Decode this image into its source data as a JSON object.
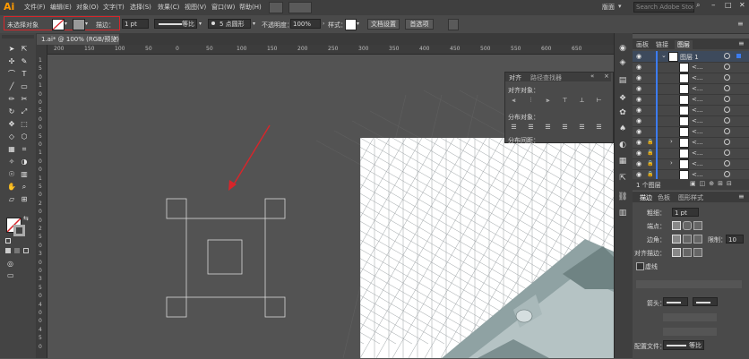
{
  "app": {
    "logo": "Ai"
  },
  "menu": [
    "文件(F)",
    "编辑(E)",
    "对象(O)",
    "文字(T)",
    "选择(S)",
    "效果(C)",
    "视图(V)",
    "窗口(W)",
    "帮助(H)"
  ],
  "window": {
    "workspace": "版面",
    "search_placeholder": "Search Adobe Stock"
  },
  "control": {
    "selection_state": "未选择对象",
    "stroke_label": "描边：",
    "stroke_weight": "1 pt",
    "line_style": "等比",
    "brush": "5 点圆形",
    "opacity_label": "不透明度：",
    "opacity_value": "100%",
    "style_label": "样式：",
    "doc_setup": "文档设置",
    "preferences": "首选项"
  },
  "document": {
    "tab_title": "1.ai* @ 100% (RGB/预览)"
  },
  "ruler": {
    "top": [
      "200",
      "150",
      "100",
      "50",
      "0",
      "50",
      "100",
      "150",
      "200",
      "250",
      "300",
      "350",
      "400",
      "450",
      "500",
      "550",
      "600",
      "650"
    ],
    "left": [
      "1",
      "5",
      "0",
      "1",
      "0",
      "0",
      "5",
      "0",
      "0",
      "5",
      "0",
      "1",
      "0",
      "0",
      "1",
      "5",
      "0",
      "2",
      "0",
      "0",
      "2",
      "5",
      "0",
      "3",
      "0",
      "0",
      "3",
      "5",
      "0",
      "4",
      "0",
      "0",
      "4",
      "5",
      "0"
    ]
  },
  "align_panel": {
    "tabs": [
      "对齐",
      "路径查找器"
    ],
    "align_objects": "对齐对象：",
    "distribute_objects": "分布对象：",
    "distribute_spacing": "分布间距："
  },
  "layers_panel": {
    "tabs": [
      "画板",
      "链接",
      "图层"
    ],
    "rows": [
      "图层 1",
      "<...",
      "<...",
      "<...",
      "<...",
      "<...",
      "<...",
      "<...",
      "<...",
      "<...",
      "<...",
      "<..."
    ],
    "footer": "1 个图层"
  },
  "stroke_panel": {
    "tabs": [
      "描边",
      "色板",
      "图形样式"
    ],
    "weight_label": "粗细：",
    "weight_value": "1 pt",
    "cap_label": "端点：",
    "corner_label": "边角：",
    "limit_label": "限制：",
    "limit_value": "10",
    "align_label": "对齐描边：",
    "dashed_label": "虚线",
    "arrow_label": "箭头：",
    "profile_label": "配置文件：",
    "profile_value": "等比"
  },
  "colors": {
    "accent": "#ff9a00",
    "highlight_red": "#d9252a",
    "annotation_arrow": "#d9252a",
    "model_fill": "#8fa2a3"
  }
}
